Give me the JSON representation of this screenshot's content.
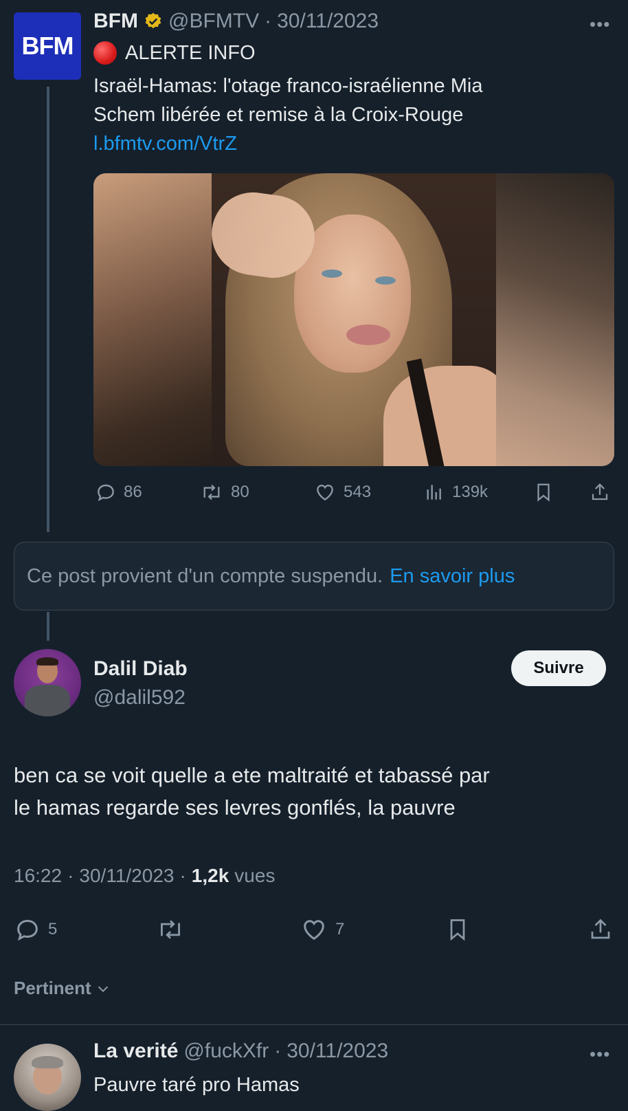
{
  "quoted": {
    "name": "BFM",
    "handle": "@BFMTV",
    "sep": "·",
    "date": "30/11/2023",
    "logo_text": "BFM",
    "alert_icon": "red-circle-emoji",
    "alert": "ALERTE INFO",
    "text_line1": "Israël-Hamas: l'otage franco-israélienne Mia",
    "text_line2": "Schem libérée et remise à la Croix-Rouge",
    "link": "l.bfmtv.com/VtrZ",
    "stats": {
      "replies": "86",
      "reposts": "80",
      "likes": "543",
      "views": "139k"
    }
  },
  "suspended": {
    "text": "Ce post provient d'un compte suspendu.",
    "link": "En savoir plus"
  },
  "main": {
    "name": "Dalil Diab",
    "handle": "@dalil592",
    "follow": "Suivre",
    "text_line1": "ben ca se voit quelle a ete maltraité et tabassé par",
    "text_line2": "le hamas regarde ses levres gonflés, la pauvre",
    "time": "16:22",
    "sep": "·",
    "date": "30/11/2023",
    "views_count": "1,2k",
    "views_label": "vues",
    "stats": {
      "replies": "5",
      "likes": "7"
    }
  },
  "sort": {
    "label": "Pertinent"
  },
  "reply": {
    "name": "La verité",
    "handle": "@fuckXfr",
    "sep": "·",
    "date": "30/11/2023",
    "text": "Pauvre taré pro Hamas"
  },
  "colors": {
    "background": "#15202b",
    "accent": "#1d9bf0",
    "muted": "#8b98a5",
    "verified": "#e2b719",
    "bfm_blue": "#1d2fb8"
  }
}
